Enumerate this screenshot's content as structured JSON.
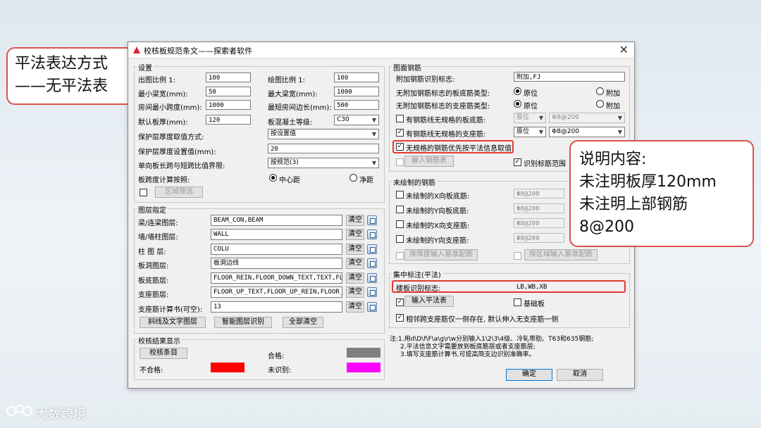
{
  "dialog": {
    "title": "校核板规范条文——探索者软件",
    "close_label": "✕"
  },
  "settings": {
    "legend": "设置",
    "fields": [
      {
        "label": "出图比例 1:",
        "value": "100"
      },
      {
        "label": "最小梁宽(mm):",
        "value": "50"
      },
      {
        "label": "房间最小跨度(mm):",
        "value": "1000"
      },
      {
        "label": "默认板厚(mm):",
        "value": "120"
      }
    ],
    "fields_right": [
      {
        "label": "绘图比例 1:",
        "value": "100"
      },
      {
        "label": "最大梁宽(mm):",
        "value": "1000"
      },
      {
        "label": "最短房间边长(mm):",
        "value": "500"
      },
      {
        "label": "板混凝土等级:",
        "value": "C30"
      }
    ],
    "cover_method_label": "保护层厚度取值方式:",
    "cover_method_value": "按设置值",
    "cover_value_label": "保护层厚度设置值(mm):",
    "cover_value": "20",
    "span_label": "单向板长跨与短跨比值界限:",
    "span_value": "按规范(3)",
    "calc_label": "板跨度计算按照:",
    "radio_center": "中心距",
    "radio_clear": "净距",
    "region_filter": "区域筛选"
  },
  "layers": {
    "legend": "图层指定",
    "clear_label": "清空",
    "rows": [
      {
        "label": "梁/连梁图层:",
        "value": "BEAM_CON,BEAM"
      },
      {
        "label": "墙/墙柱图层:",
        "value": "WALL"
      },
      {
        "label": "柱 图 层:",
        "value": "COLU"
      },
      {
        "label": "板洞图层:",
        "value": "板洞边线"
      },
      {
        "label": "板底筋层:",
        "value": "FLOOR_REIN,FLOOR_DOWN_TEXT,TEXT,FL"
      },
      {
        "label": "支座筋层:",
        "value": "FLOOR_UP_TEXT,FLOOR_UP_REIN,FLOOR_"
      },
      {
        "label": "支座筋计算书(可空):",
        "value": "13"
      }
    ],
    "btn_lines": "斜线及文字图层",
    "btn_smart": "智能图层识别",
    "btn_clear_all": "全部清空"
  },
  "results": {
    "legend": "校核结果显示",
    "items_btn": "校核条目",
    "pass_label": "合格:",
    "fail_label": "不合格:",
    "unknown_label": "未识别:",
    "colors": {
      "pass": "#7f7f7f",
      "fail": "#ff0000",
      "unknown": "#ff00ff"
    }
  },
  "rebar": {
    "legend": "图面钢筋",
    "add_mark_label": "附加钢筋识别标志:",
    "add_mark_value": "附加,FJ",
    "bottom_type_label": "无附加钢筋标志的板底筋类型:",
    "support_type_label": "无附加钢筋标志的支座筋类型:",
    "opt_orig": "原位",
    "opt_add": "附加",
    "bottom_irregular_label": "有钢筋线无规格的板底筋:",
    "bottom_irregular_pos": "原位",
    "bottom_irregular_spec": "Φ8@200",
    "support_irregular_label": "有钢筋线无规格的支座筋:",
    "support_irregular_pos": "原位",
    "support_irregular_spec": "Φ8@200",
    "priority_label": "无规格的钢筋优先按平法信息取值",
    "input_table": "输入钢筋表",
    "recognize_range": "识别标筋范围"
  },
  "undrawn": {
    "legend": "未绘制的钢筋",
    "rows": [
      {
        "label": "未绘制的X向板底筋:",
        "value": "Φ8@200"
      },
      {
        "label": "未绘制的Y向板底筋:",
        "value": "Φ8@200"
      },
      {
        "label": "未绘制的X向支座筋:",
        "value": "Φ8@200"
      },
      {
        "label": "未绘制的Y向支座筋:",
        "value": "Φ8@200"
      }
    ],
    "btn_by_thickness": "按厚度输入基准配筋",
    "btn_by_region": "按区域输入基准配筋"
  },
  "centralized": {
    "legend": "集中标注(平法)",
    "mark_label": "楼板识别标志:",
    "mark_value": "LB,WB,XB",
    "input_table": "输入平法表",
    "foundation": "基础板",
    "adjacent": "相邻跨支座筋仅一侧存在, 默认伸入无支座筋一侧"
  },
  "notes": [
    "注:1.用d\\D\\f\\F\\a\\g\\r\\w分别输入1\\2\\3\\4级、冷轧带肋、T63和635钢筋;",
    "2.平法信息文字需要放到板底筋层或者支座筋层;",
    "3.填写支座筋计算书,可提高简支边识别准确率。"
  ],
  "footer": {
    "ok": "确定",
    "cancel": "取消"
  },
  "callout_left": {
    "line1": "平法表达方式",
    "line2": "——无平法表"
  },
  "callout_right": {
    "line1": "说明内容:",
    "line2": "未注明板厚120mm",
    "line3": "未注明上部钢筋",
    "line4": "8@200"
  },
  "watermark": "大数跨境"
}
